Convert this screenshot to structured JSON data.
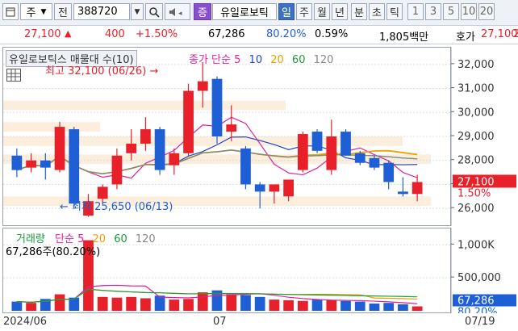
{
  "toolbar": {
    "market": "주",
    "search_label": "전",
    "code": "388720",
    "sector_badge": "증",
    "stock_name": "유일로보틱",
    "periods": [
      "일",
      "주",
      "월",
      "년",
      "분",
      "초",
      "틱"
    ],
    "active_period": "일",
    "intervals": [
      "1",
      "3",
      "5",
      "10",
      "20"
    ]
  },
  "quote": {
    "price": "27,100",
    "change": "400",
    "change_pct": "+1.50%",
    "volume": "67,286",
    "volume_ratio": "80.20%",
    "turnover": "0.59%",
    "amount": "1,805백만",
    "ask_label": "호가",
    "ask_price": "27,100",
    "ask_more": "2"
  },
  "price_panel": {
    "title": "유일로보틱스 매물대 수(10)",
    "ma_label": "종가 단순",
    "ma_periods": [
      "5",
      "10",
      "20",
      "60",
      "120"
    ],
    "high_note": "최고 32,100 (06/26)",
    "low_note": "최저 25,650 (06/13)",
    "y_ticks": [
      "32,000",
      "31,000",
      "30,000",
      "29,000",
      "28,000",
      "27,000",
      "26,000"
    ],
    "current_price": "27,100",
    "current_pct": "1.50%"
  },
  "volume_panel": {
    "title": "거래량",
    "ma_label": "단순",
    "ma_periods": [
      "5",
      "20",
      "60",
      "120"
    ],
    "summary": "67,286주(80.20%)",
    "y_ticks": [
      "1,000K",
      "500,000"
    ],
    "current_volume": "67,286",
    "current_ratio": "80.20%"
  },
  "x_axis": {
    "labels": [
      "2024/06",
      "07",
      "07/19"
    ]
  },
  "colors": {
    "up": "#e8202a",
    "down": "#1f5fd6",
    "ma5": "#e0209a",
    "ma10": "#2244cc",
    "ma20": "#f0a000",
    "ma60": "#1a9a3a",
    "ma120": "#888888"
  },
  "chart_data": {
    "type": "candlestick",
    "y_range": [
      25500,
      32500
    ],
    "candles": [
      {
        "o": 28200,
        "h": 28500,
        "l": 27300,
        "c": 27600
      },
      {
        "o": 27700,
        "h": 28300,
        "l": 27500,
        "c": 28000
      },
      {
        "o": 28000,
        "h": 28300,
        "l": 27200,
        "c": 27700
      },
      {
        "o": 27600,
        "h": 29600,
        "l": 27500,
        "c": 29400
      },
      {
        "o": 29300,
        "h": 29400,
        "l": 26000,
        "c": 26200
      },
      {
        "o": 25700,
        "h": 26600,
        "l": 25650,
        "c": 26300
      },
      {
        "o": 26400,
        "h": 27000,
        "l": 26200,
        "c": 26900
      },
      {
        "o": 27000,
        "h": 28500,
        "l": 26800,
        "c": 28200
      },
      {
        "o": 28300,
        "h": 29300,
        "l": 28000,
        "c": 28700
      },
      {
        "o": 28700,
        "h": 29800,
        "l": 28400,
        "c": 29300
      },
      {
        "o": 29300,
        "h": 29400,
        "l": 27400,
        "c": 27600
      },
      {
        "o": 27800,
        "h": 28500,
        "l": 27400,
        "c": 28300
      },
      {
        "o": 28300,
        "h": 31200,
        "l": 28200,
        "c": 30900
      },
      {
        "o": 30900,
        "h": 32100,
        "l": 30200,
        "c": 31300
      },
      {
        "o": 31400,
        "h": 31500,
        "l": 28700,
        "c": 29000
      },
      {
        "o": 29200,
        "h": 30300,
        "l": 28800,
        "c": 29500
      },
      {
        "o": 28500,
        "h": 28600,
        "l": 26800,
        "c": 27000
      },
      {
        "o": 27000,
        "h": 27100,
        "l": 26000,
        "c": 26700
      },
      {
        "o": 26700,
        "h": 27000,
        "l": 26200,
        "c": 27000
      },
      {
        "o": 26500,
        "h": 27000,
        "l": 26300,
        "c": 27200
      },
      {
        "o": 27600,
        "h": 29200,
        "l": 27500,
        "c": 29100
      },
      {
        "o": 29200,
        "h": 29300,
        "l": 28300,
        "c": 28400
      },
      {
        "o": 27600,
        "h": 29700,
        "l": 27400,
        "c": 29000
      },
      {
        "o": 29200,
        "h": 29300,
        "l": 28200,
        "c": 28200
      },
      {
        "o": 28300,
        "h": 28400,
        "l": 27800,
        "c": 27900
      },
      {
        "o": 28100,
        "h": 28200,
        "l": 27600,
        "c": 27700
      },
      {
        "o": 27900,
        "h": 28000,
        "l": 26800,
        "c": 27100
      },
      {
        "o": 26700,
        "h": 27300,
        "l": 26500,
        "c": 26600
      },
      {
        "o": 26600,
        "h": 27400,
        "l": 26300,
        "c": 27100
      }
    ],
    "volume": [
      140000,
      120000,
      180000,
      250000,
      200000,
      1070000,
      210000,
      200000,
      210000,
      190000,
      230000,
      170000,
      180000,
      280000,
      310000,
      250000,
      240000,
      210000,
      170000,
      160000,
      150000,
      170000,
      160000,
      150000,
      140000,
      110000,
      120000,
      100000,
      67286
    ]
  }
}
